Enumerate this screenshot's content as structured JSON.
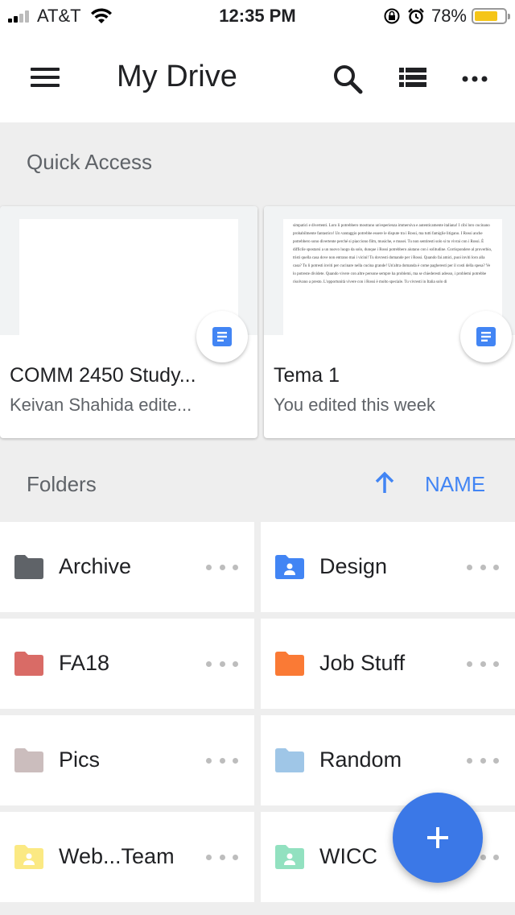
{
  "status_bar": {
    "carrier": "AT&T",
    "time": "12:35 PM",
    "battery_percent": "78%",
    "battery_level": 0.78,
    "icons": [
      "signal-icon",
      "wifi-icon",
      "rotation-lock-icon",
      "alarm-icon",
      "battery-icon"
    ]
  },
  "app_bar": {
    "title": "My Drive",
    "icons": [
      "menu-icon",
      "search-icon",
      "list-view-icon",
      "more-icon"
    ]
  },
  "quick_access": {
    "header": "Quick Access",
    "items": [
      {
        "title": "COMM 2450 Study...",
        "subtitle": "Keivan Shahida edite...",
        "type_icon": "docs-icon"
      },
      {
        "title": "Tema 1",
        "subtitle": "You edited this week",
        "type_icon": "docs-icon",
        "preview_text": "simpatici e divertenti. Loro li potrebbero mostrano un'esperienza immersiva e autenticamente italiana! I cibi loro cucinano probabilmente fantastico! Un vantaggio potrebbe essere le dispute tra i Rossi, ma tutti famiglie litigano. I Rossi anche potrebbero sono divertente perché si piacciono film, musiche, e musei. Tu non sentiresti solo si tu vivrai con i Rossi. È difficile spostarsi a un nuovo luogo da solo, dunque i Rossi potrebbero aiutano con i solitudine. Corrispondere al proverbio, tristi quella casa dove non entrano mai i vicini! Tu dovresti domande per i Rossi. Quando fai amici, puoi inviti loro alla casa? Tu li potresti inviti per cucinare nella cucina grande! Un'altra domanda è come pagheresti per il costi della spesa? Ve lo potreste dividete. Quando vivere con altre persone sempre ha problemi, ma se chiederesti adesso, i problemi potrebbe risolvano a presto. L'opportunità vivere con i Rossi è molto speciale. Tu vivresti in Italia solo di"
      }
    ]
  },
  "folders": {
    "header": "Folders",
    "sort_label": "NAME",
    "sort_direction": "ascending",
    "items": [
      {
        "name": "Archive",
        "color": "#5f6368",
        "kind": "plain"
      },
      {
        "name": "Design",
        "color": "#4285f4",
        "kind": "shared"
      },
      {
        "name": "FA18",
        "color": "#d96b66",
        "kind": "plain"
      },
      {
        "name": "Job Stuff",
        "color": "#fa7a35",
        "kind": "plain"
      },
      {
        "name": "Pics",
        "color": "#cbbdbd",
        "kind": "plain"
      },
      {
        "name": "Random",
        "color": "#9fc6e7",
        "kind": "plain"
      },
      {
        "name": "Web...Team",
        "color": "#fbe983",
        "kind": "shared"
      },
      {
        "name": "WICC",
        "color": "#92e1c0",
        "kind": "shared"
      }
    ]
  },
  "fab": {
    "icon": "plus-icon",
    "color": "#3b78e7"
  }
}
